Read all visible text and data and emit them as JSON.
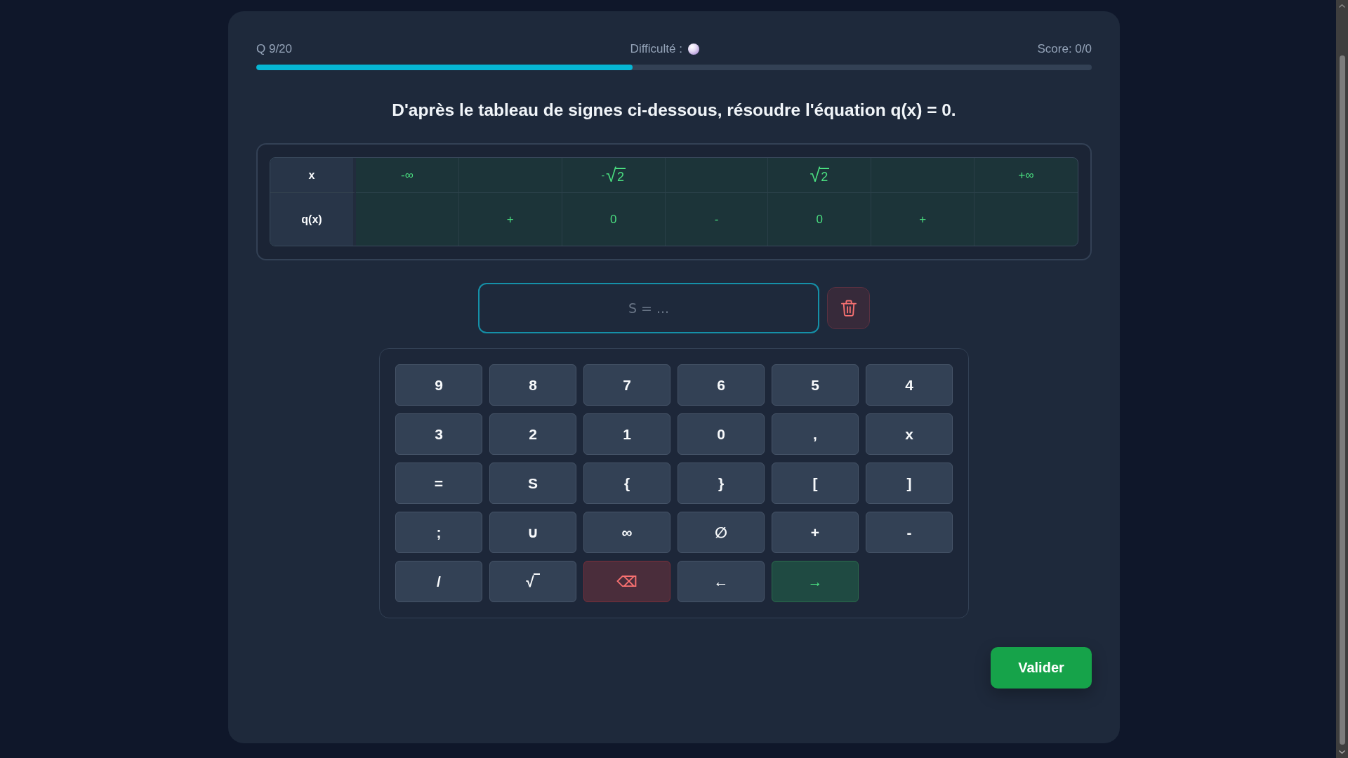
{
  "header": {
    "question_counter": "Q 9/20",
    "difficulty_label": "Difficulté :",
    "score": "Score: 0/0"
  },
  "progress": {
    "level": 0.45
  },
  "question": "D'après le tableau de signes ci-dessous, résoudre l'équation q(x) = 0.",
  "sign_table": {
    "rows": [
      {
        "label": "x",
        "cells": [
          {
            "kind": "text",
            "text": "-∞"
          },
          null,
          {
            "kind": "root",
            "prefix": "-",
            "radical": "√",
            "radicand": "2"
          },
          null,
          {
            "kind": "root",
            "radical": "√",
            "radicand": "2"
          },
          null,
          {
            "kind": "text",
            "text": "+∞"
          }
        ]
      },
      {
        "label": "q(x)",
        "cells": [
          null,
          {
            "kind": "text",
            "text": "+"
          },
          {
            "kind": "text",
            "text": "0"
          },
          {
            "kind": "text",
            "text": "-"
          },
          {
            "kind": "text",
            "text": "0"
          },
          {
            "kind": "text",
            "text": "+"
          },
          null
        ]
      }
    ]
  },
  "answer": {
    "placeholder": "S = ..."
  },
  "keypad": {
    "keys": [
      {
        "label": "9",
        "kind": "symbol"
      },
      {
        "label": "8",
        "kind": "symbol"
      },
      {
        "label": "7",
        "kind": "symbol"
      },
      {
        "label": "6",
        "kind": "symbol"
      },
      {
        "label": "5",
        "kind": "symbol"
      },
      {
        "label": "4",
        "kind": "symbol"
      },
      {
        "label": "3",
        "kind": "symbol"
      },
      {
        "label": "2",
        "kind": "symbol"
      },
      {
        "label": "1",
        "kind": "symbol"
      },
      {
        "label": "0",
        "kind": "symbol"
      },
      {
        "label": ",",
        "kind": "symbol"
      },
      {
        "label": "x",
        "kind": "symbol"
      },
      {
        "label": "=",
        "kind": "symbol"
      },
      {
        "label": "S",
        "kind": "symbol"
      },
      {
        "label": "{",
        "kind": "symbol"
      },
      {
        "label": "}",
        "kind": "symbol"
      },
      {
        "label": "[",
        "kind": "symbol"
      },
      {
        "label": "]",
        "kind": "symbol"
      },
      {
        "label": ";",
        "kind": "symbol"
      },
      {
        "label": "∪",
        "kind": "symbol"
      },
      {
        "label": "∞",
        "kind": "symbol"
      },
      {
        "label": "∅",
        "kind": "symbol"
      },
      {
        "label": "+",
        "kind": "symbol"
      },
      {
        "label": "-",
        "kind": "symbol"
      },
      {
        "label": "/",
        "kind": "symbol"
      },
      {
        "label": "√",
        "kind": "root"
      },
      {
        "label": "⌫",
        "kind": "erase"
      },
      {
        "label": "←",
        "kind": "symbol"
      },
      {
        "label": "→",
        "kind": "confirm"
      }
    ]
  },
  "submit": {
    "label": "Valider"
  }
}
